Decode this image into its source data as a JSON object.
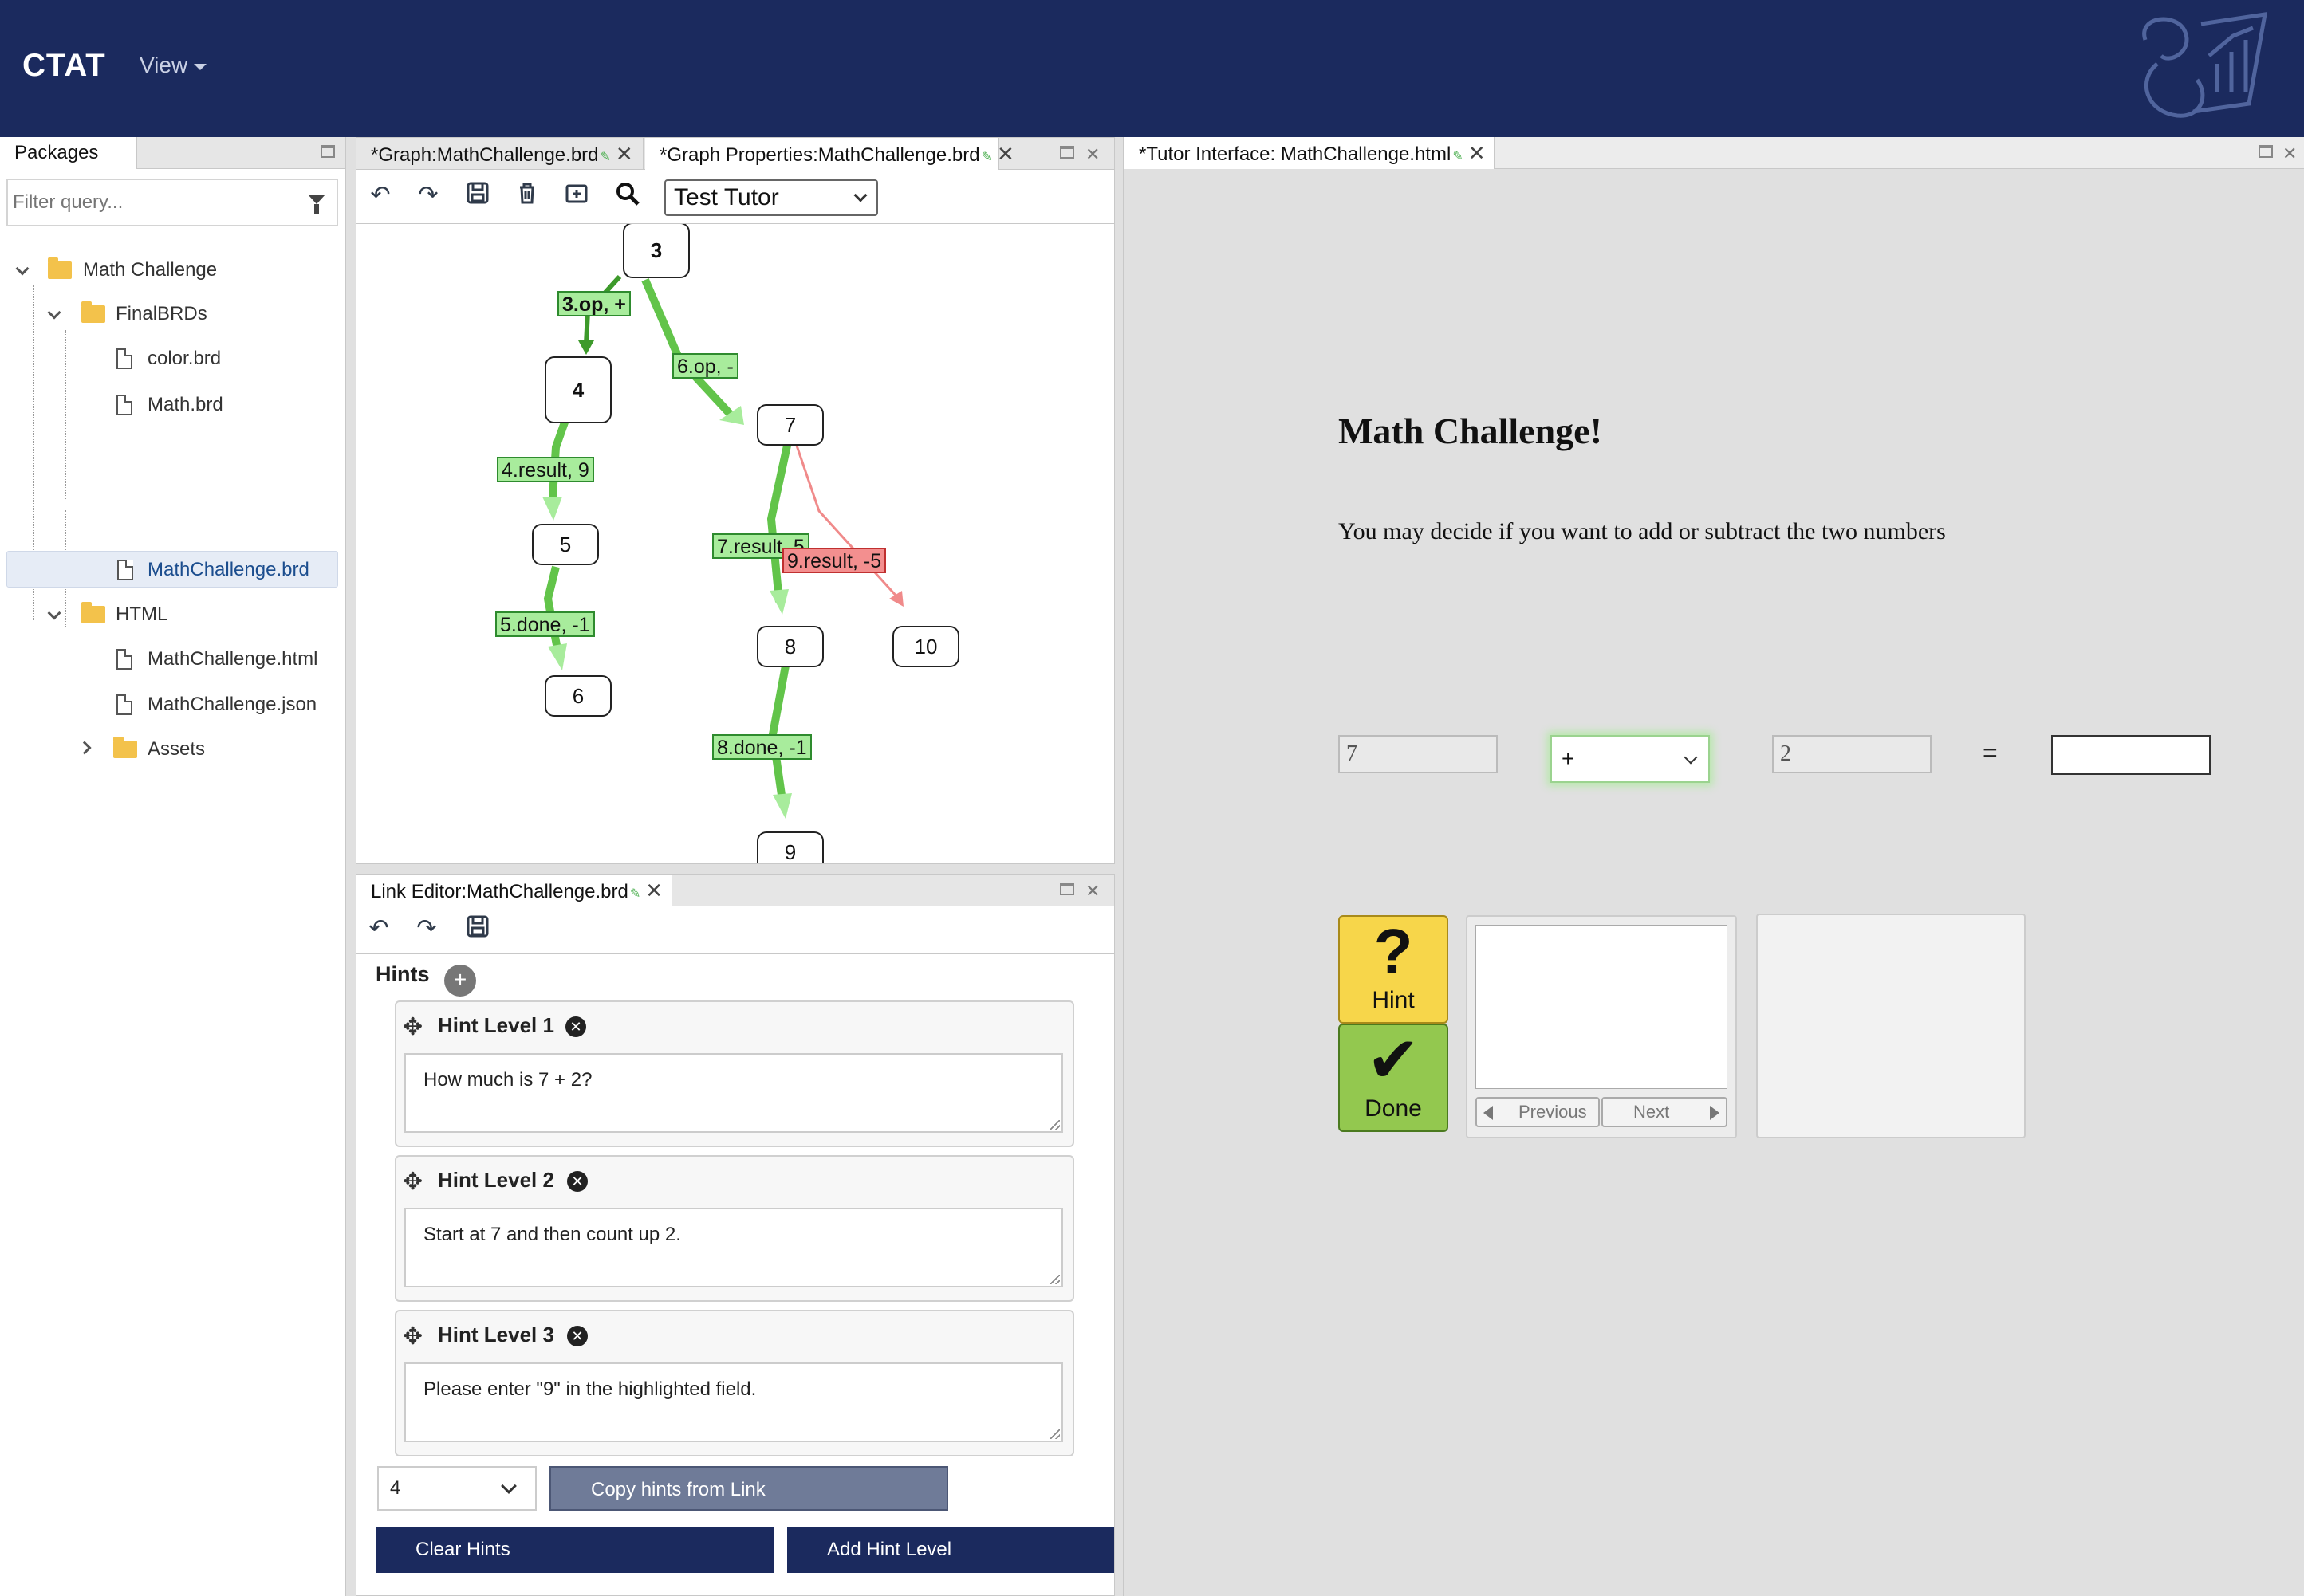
{
  "app": {
    "title": "CTAT",
    "view_menu": "View"
  },
  "packages": {
    "tab_label": "Packages",
    "filter_placeholder": "Filter query...",
    "tree": [
      {
        "label": "Math Challenge",
        "type": "folder",
        "expanded": true
      },
      {
        "label": "FinalBRDs",
        "type": "folder",
        "expanded": true
      },
      {
        "label": "color.brd",
        "type": "file"
      },
      {
        "label": "Math.brd",
        "type": "file"
      },
      {
        "label": "MathChallenge.brd",
        "type": "file",
        "selected": true
      },
      {
        "label": "HTML",
        "type": "folder",
        "expanded": true
      },
      {
        "label": "MathChallenge.html",
        "type": "file"
      },
      {
        "label": "MathChallenge.json",
        "type": "file"
      },
      {
        "label": "Assets",
        "type": "folder",
        "expanded": false
      }
    ]
  },
  "graph_panel": {
    "tabs": [
      {
        "label": "*Graph:MathChallenge.brd"
      },
      {
        "label": "*Graph Properties:MathChallenge.brd"
      }
    ],
    "tutor_mode": "Test Tutor",
    "nodes": [
      "3",
      "4",
      "5",
      "6",
      "7",
      "8",
      "9",
      "10"
    ],
    "edges": [
      "3.op, +",
      "6.op, -",
      "4.result, 9",
      "5.done, -1",
      "7.result, 5",
      "9.result, -5",
      "8.done, -1"
    ]
  },
  "link_editor": {
    "tab_label": "Link Editor:MathChallenge.brd",
    "hints_heading": "Hints",
    "hint_add": "+",
    "hints": [
      {
        "title": "Hint Level 1",
        "text": "How much is 7 + 2?"
      },
      {
        "title": "Hint Level 2",
        "text": "Start at 7 and then count up 2."
      },
      {
        "title": "Hint Level 3",
        "text": "Please enter \"9\" in the highlighted field."
      }
    ],
    "link_select": "4",
    "copy_label": "Copy hints from Link",
    "clear_label": "Clear Hints",
    "add_label": "Add Hint Level"
  },
  "tutor": {
    "tab_label": "*Tutor Interface: MathChallenge.html",
    "heading": "Math Challenge!",
    "instructions": "You may decide if you want to add or subtract the two numbers",
    "operand1": "7",
    "operator": "+",
    "operand2": "2",
    "equals": "=",
    "hint_label": "Hint",
    "done_label": "Done",
    "previous_label": "Previous",
    "next_label": "Next"
  }
}
